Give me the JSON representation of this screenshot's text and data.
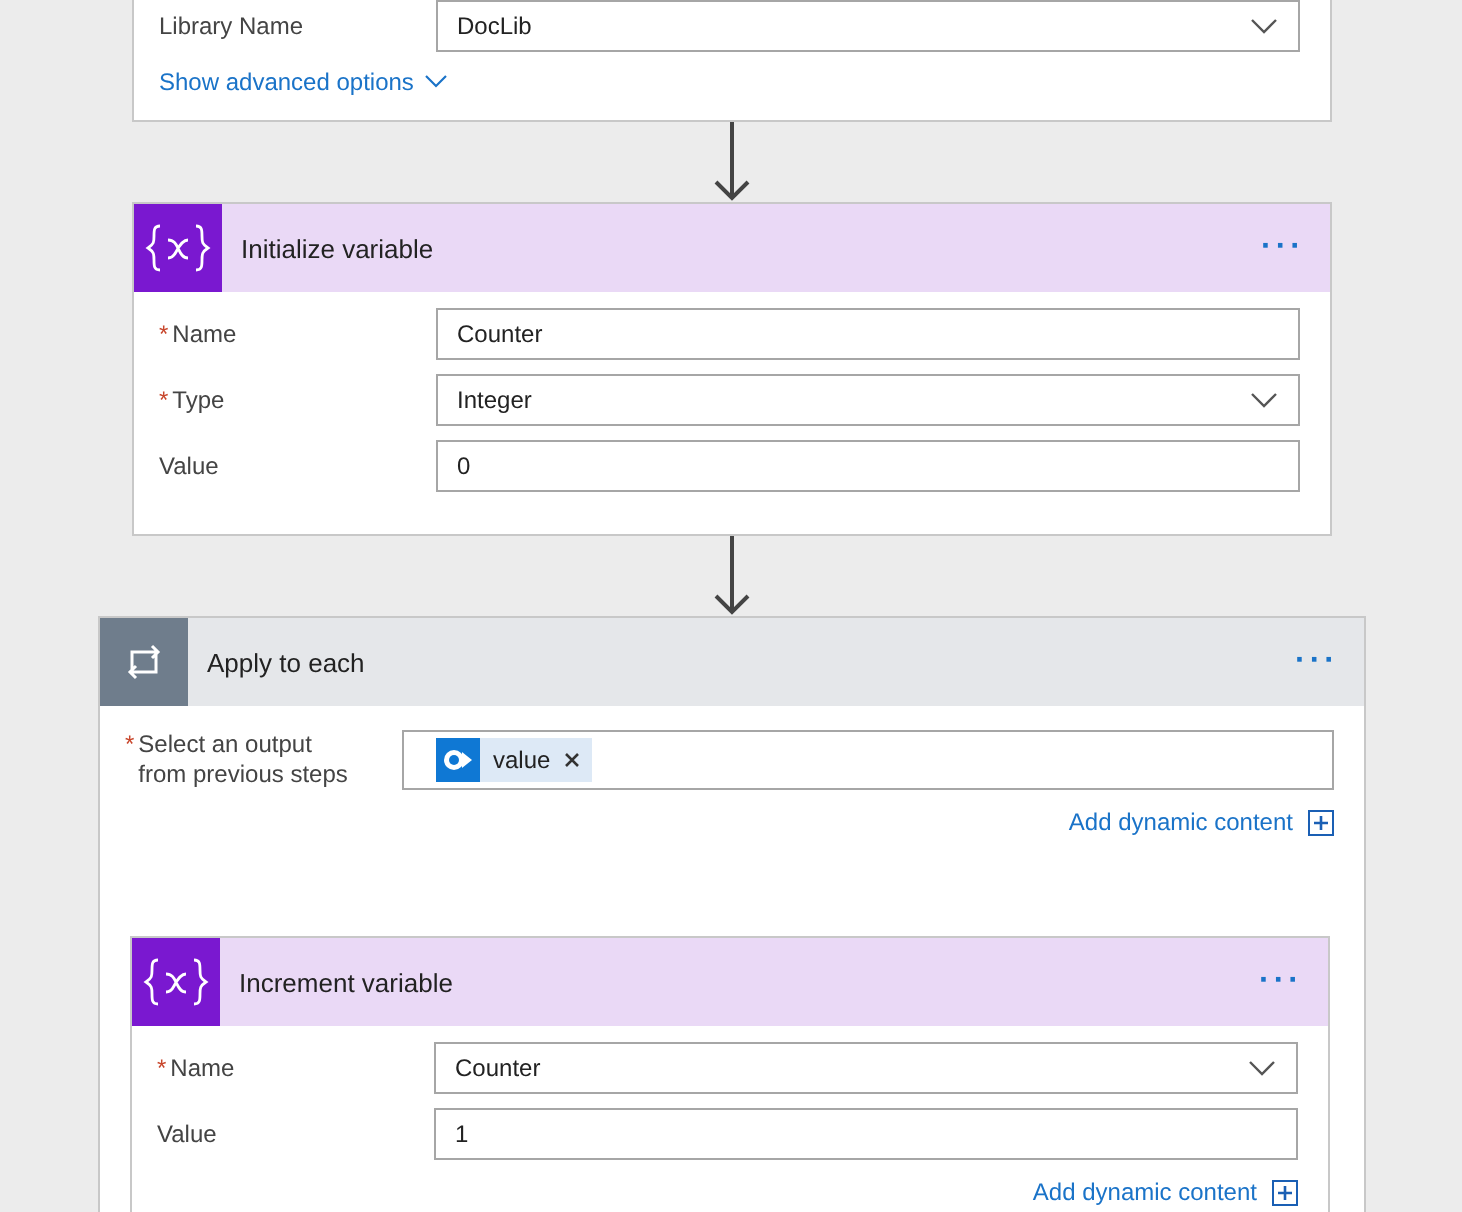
{
  "top_card": {
    "fields": [
      {
        "label": "Library Name",
        "value": "DocLib",
        "kind": "dropdown"
      }
    ],
    "link": "Show advanced options"
  },
  "init_step": {
    "kind": "variable",
    "title": "Initialize variable",
    "menu": "···",
    "fields": [
      {
        "mark": "*",
        "label": "Name",
        "value": "Counter",
        "kind": "text"
      },
      {
        "mark": "*",
        "label": "Type",
        "value": "Integer",
        "kind": "dropdown"
      },
      {
        "label": "Value",
        "value": "0",
        "kind": "text"
      }
    ]
  },
  "loop_step": {
    "kind": "loop",
    "title": "Apply to each",
    "menu": "···",
    "fields": [
      {
        "mark": "*",
        "label": "Select an output from previous steps",
        "value": "value",
        "kind": "token"
      }
    ],
    "link": "Add dynamic content",
    "inner_step": {
      "kind": "variable",
      "title": "Increment variable",
      "menu": "···",
      "fields": [
        {
          "mark": "*",
          "label": "Name",
          "value": "Counter",
          "kind": "dropdown"
        },
        {
          "label": "Value",
          "value": "1",
          "kind": "text"
        }
      ],
      "link": "Add dynamic content"
    }
  }
}
